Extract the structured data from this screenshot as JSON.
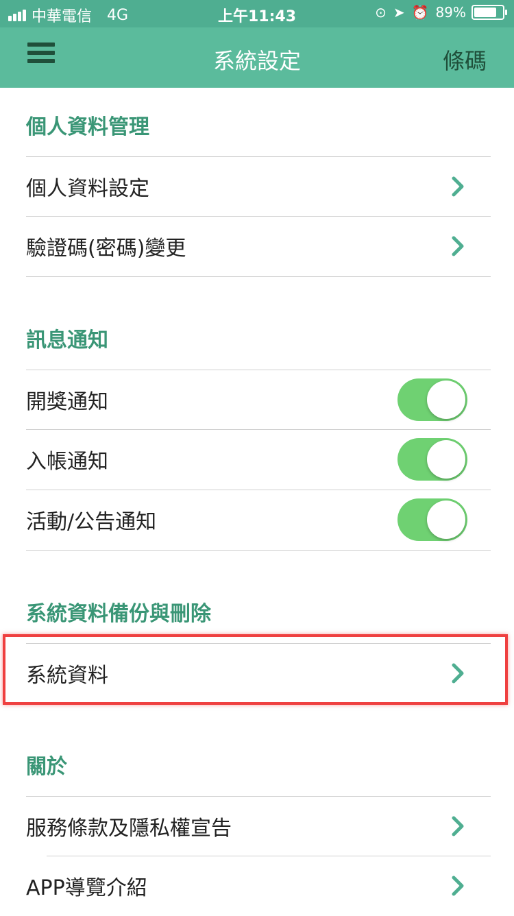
{
  "status_bar": {
    "carrier": "中華電信",
    "network": "4G",
    "time": "上午11:43",
    "battery_percent": "89%",
    "battery_level": 0.89
  },
  "nav": {
    "title": "系統設定",
    "right_label": "條碼",
    "menu_icon": "hamburger-menu-icon"
  },
  "sections": {
    "personal": {
      "header": "個人資料管理",
      "items": [
        "個人資料設定",
        "驗證碼(密碼)變更"
      ]
    },
    "notify": {
      "header": "訊息通知",
      "items": [
        "開獎通知",
        "入帳通知",
        "活動/公告通知"
      ],
      "toggles_on": [
        true,
        true,
        true
      ]
    },
    "backup": {
      "header": "系統資料備份與刪除",
      "items": [
        "系統資料"
      ]
    },
    "about": {
      "header": "關於",
      "items": [
        "服務條款及隱私權宣告",
        "APP導覽介紹"
      ]
    }
  },
  "colors": {
    "status_bar": "#4fae91",
    "nav_bar": "#5bbb9c",
    "section_header": "#3a9676",
    "toggle_on": "#6fd172",
    "chevron": "#4fae91",
    "highlight": "#ef4040"
  }
}
